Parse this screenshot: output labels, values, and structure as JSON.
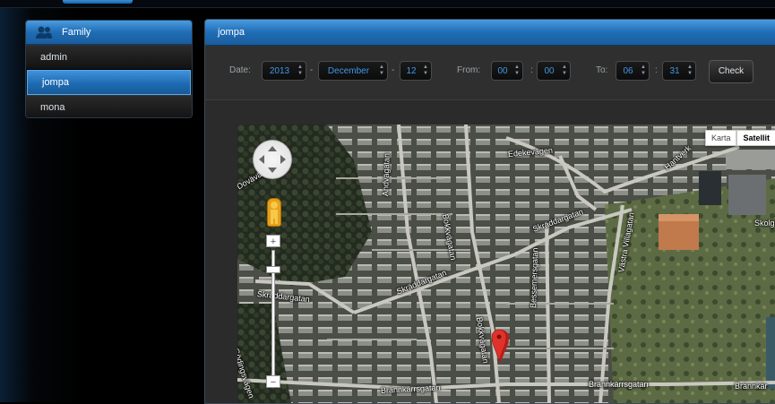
{
  "family": {
    "title": "Family",
    "icon": "users-icon",
    "members": [
      "admin",
      "jompa",
      "mona"
    ],
    "active": "jompa"
  },
  "main": {
    "title": "jompa",
    "toolbar": {
      "date_label": "Date:",
      "year": "2013",
      "month": "December",
      "day": "12",
      "from_label": "From:",
      "from_hour": "00",
      "from_min": "00",
      "to_label": "To:",
      "to_hour": "06",
      "to_min": "31",
      "dash": "-",
      "colon": ":",
      "check_label": "Check"
    }
  },
  "map": {
    "type_controls": {
      "map": "Karta",
      "satellite": "Satellit",
      "selected": "Satellit"
    },
    "zoom_in": "+",
    "zoom_out": "−",
    "labels": {
      "l1": "Edekevägen",
      "l2": "Hantverk",
      "l3": "Skräddargatan",
      "l4": "Skräddargatan",
      "l5": "Skräddargatan",
      "l6": "Andvägatan",
      "l7": "Bokkvägatan",
      "l8": "Bokkvägatan",
      "l9": "Bessemersgatan",
      "l10": "Västra Villagatan",
      "l11": "Brännkärrsgatan",
      "l12": "Brännkärrsgatan",
      "l13": "Brännkär",
      "l14": "Skolga",
      "l15": "Dovävägen",
      "l16": "Gödingsvägen"
    }
  },
  "colors": {
    "accent": "#1f6db5",
    "select_text": "#3f97e8",
    "marker": "#e0322b"
  }
}
